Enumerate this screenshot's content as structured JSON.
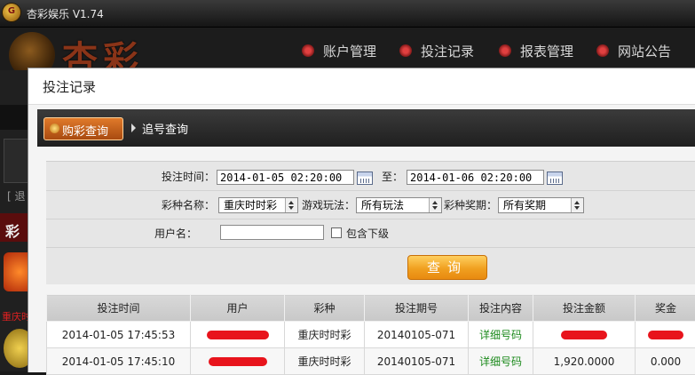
{
  "app": {
    "logo_char": "G",
    "title": "杏彩娱乐 V1.74"
  },
  "brand": {
    "word": "杏彩"
  },
  "topnav": [
    {
      "label": "账户管理"
    },
    {
      "label": "投注记录"
    },
    {
      "label": "报表管理"
    },
    {
      "label": "网站公告"
    }
  ],
  "sidebar": {
    "link_fragment": "[ 退",
    "section_fragment": "彩",
    "game_caption_fragment": "重庆时"
  },
  "dialog": {
    "title": "投注记录",
    "tabs": [
      {
        "label": "购彩查询",
        "active": true
      },
      {
        "label": "追号查询",
        "active": false
      }
    ],
    "form": {
      "bet_time_label": "投注时间：",
      "start_time": "2014-01-05 02:20:00",
      "to_label": "至：",
      "end_time": "2014-01-06 02:20:00",
      "lottery_label": "彩种名称：",
      "lottery_value": "重庆时时彩",
      "play_label": "游戏玩法：",
      "play_value": "所有玩法",
      "period_label": "彩种奖期：",
      "period_value": "所有奖期",
      "username_label": "用户名：",
      "username_value": "",
      "include_sub_label": "包含下级",
      "include_sub_checked": false,
      "query_button": "查询"
    },
    "table": {
      "columns": [
        "投注时间",
        "用户",
        "彩种",
        "投注期号",
        "投注内容",
        "投注金额",
        "奖金"
      ],
      "rows": [
        {
          "time": "2014-01-05 17:45:53",
          "user": "",
          "lottery": "重庆时时彩",
          "period": "20140105-071",
          "content": "详细号码",
          "amount": "",
          "prize": ""
        },
        {
          "time": "2014-01-05 17:45:10",
          "user": "",
          "lottery": "重庆时时彩",
          "period": "20140105-071",
          "content": "详细号码",
          "amount": "1,920.0000",
          "prize": "0.000"
        }
      ]
    }
  },
  "colors": {
    "accent_orange": "#e88a10",
    "redaction": "#e8141c",
    "link_green": "#1c8a1c",
    "header_dark": "#1c1c1c"
  }
}
